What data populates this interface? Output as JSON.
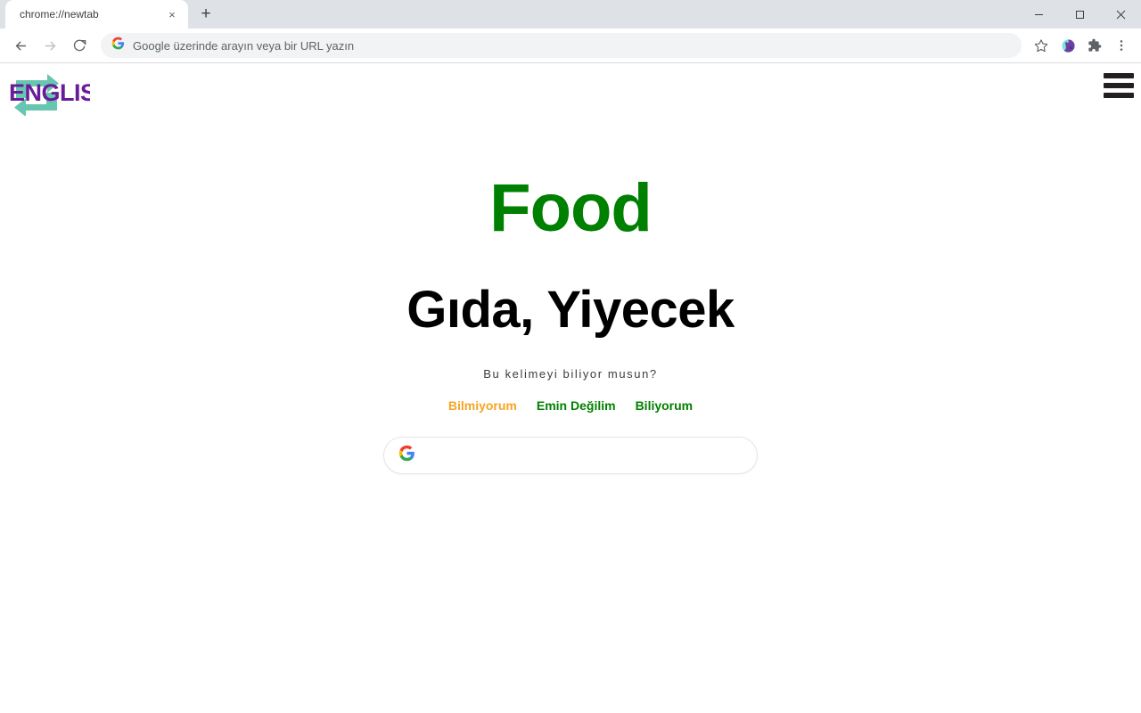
{
  "browser": {
    "tab": {
      "title": "chrome://newtab",
      "close_label": "×",
      "newtab_label": "+"
    },
    "window_controls": {
      "minimize": "minimize-icon",
      "maximize": "maximize-icon",
      "close": "close-icon"
    },
    "toolbar": {
      "back": "back-arrow-icon",
      "forward": "forward-arrow-icon",
      "reload": "reload-icon",
      "omnibox_placeholder": "Google üzerinde arayın veya bir URL yazın",
      "omnibox_value": "",
      "bookmark": "star-icon",
      "extension_globe": "globe-extension-icon",
      "extensions": "puzzle-piece-icon",
      "menu": "three-dot-menu-icon"
    }
  },
  "site": {
    "logo_text": "ENGLISH",
    "logo_colors": {
      "text": "#6A1B9A",
      "arrows": "#67c5b0"
    },
    "menu_label": "hamburger-menu-icon"
  },
  "main": {
    "word_en": "Food",
    "word_tr": "Gıda, Yiyecek",
    "question": "Bu kelimeyi biliyor musun?",
    "answers": [
      {
        "label": "Bilmiyorum",
        "color": "#f22418"
      },
      {
        "label": "Emin Değilim",
        "color": "#f5a623"
      },
      {
        "label": "Biliyorum",
        "color": "#008000"
      }
    ],
    "search": {
      "icon": "google-g-icon",
      "value": "",
      "placeholder": ""
    }
  },
  "colors": {
    "word_en": "#008000",
    "word_tr": "#000000",
    "question": "#3c3c3c",
    "page_bg": "#ffffff"
  }
}
